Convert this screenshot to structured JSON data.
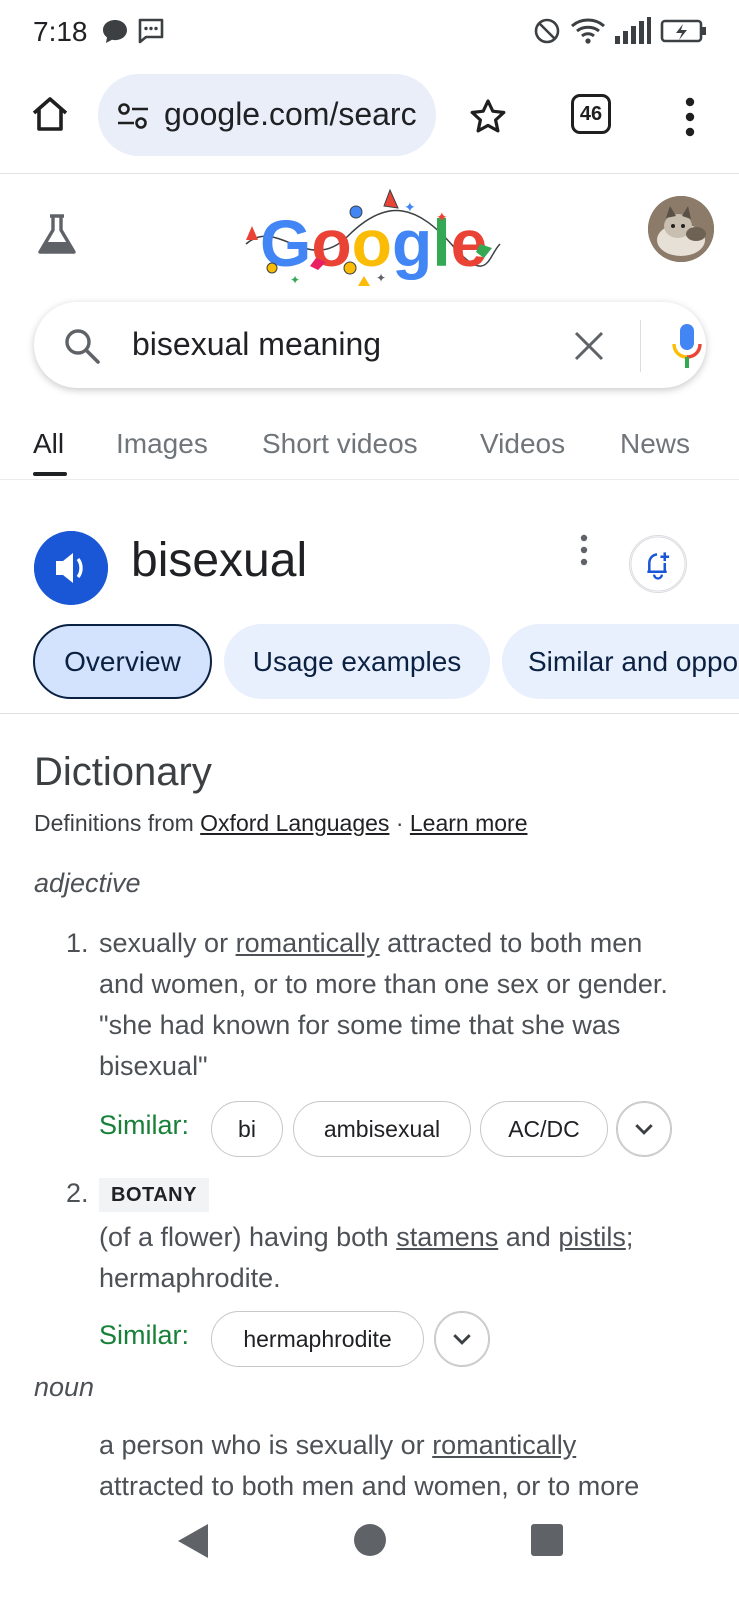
{
  "status_bar": {
    "time": "7:18"
  },
  "browser": {
    "url": "google.com/searc",
    "tab_count": "46"
  },
  "search": {
    "query": "bisexual meaning"
  },
  "search_tabs": [
    {
      "label": "All"
    },
    {
      "label": "Images"
    },
    {
      "label": "Short videos"
    },
    {
      "label": "Videos"
    },
    {
      "label": "News"
    }
  ],
  "entry": {
    "word": "bisexual"
  },
  "chips": [
    {
      "label": "Overview"
    },
    {
      "label": "Usage examples"
    },
    {
      "label": "Similar and opposite words"
    }
  ],
  "dictionary": {
    "title": "Dictionary",
    "source_prefix": "Definitions from",
    "source_link": "Oxford Languages",
    "separator": "·",
    "learn_more": "Learn more",
    "adjective": {
      "pos": "adjective",
      "sense1": {
        "number": "1.",
        "line1_a": "sexually or",
        "line1_link": "romantically",
        "line1_b": "attracted to both men",
        "line2": "and women, or to more than one sex or gender.",
        "example_line1": "\"she had known for some time that she was",
        "example_line2": "bisexual\"",
        "similar_label": "Similar:",
        "similar": [
          "bi",
          "ambisexual",
          "AC/DC"
        ]
      },
      "sense2": {
        "number": "2.",
        "label": "BOTANY",
        "line1_a": "(of a flower) having both",
        "line1_link1": "stamens",
        "line1_mid": "and",
        "line1_link2": "pistils",
        "line1_end": ";",
        "line2": "hermaphrodite.",
        "similar_label": "Similar:",
        "similar": [
          "hermaphrodite"
        ]
      }
    },
    "noun": {
      "pos": "noun",
      "line1_a": "a person who is sexually or",
      "line1_link": "romantically",
      "line2": "attracted to both men and women, or to more"
    }
  }
}
